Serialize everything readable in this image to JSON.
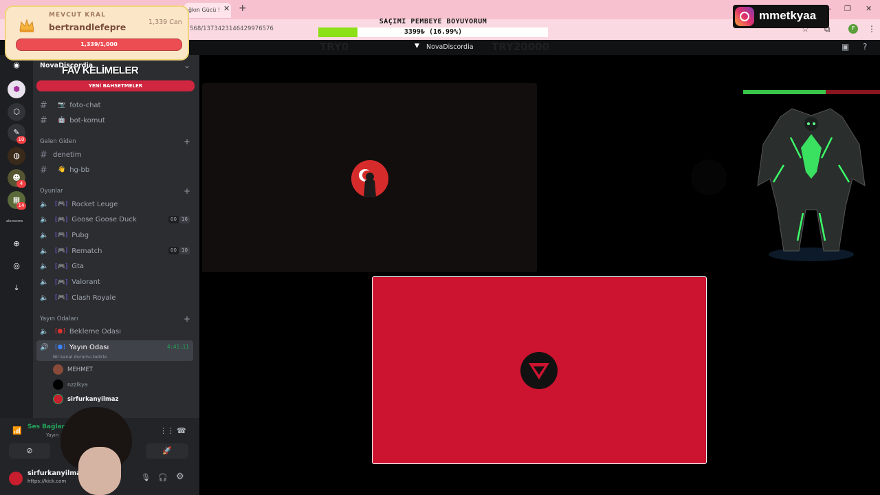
{
  "browser": {
    "tab_title": "ğkın Gücü !",
    "url": "568/1373423146429976576"
  },
  "donation": {
    "title": "SAÇIMI PEMBEYE BOYUYORUM",
    "amount": "3399₺ (16.99%)",
    "progress": 0.1699
  },
  "instagram": {
    "handle": "mmetkyaa"
  },
  "discord": {
    "server_name": "NovaDiscordia",
    "header_ghost_left": "TRY0",
    "header_ghost_right": "TRY20000"
  },
  "king": {
    "label": "MEVCUT KRAL",
    "name": "bertrandlefepre",
    "currency": "1,339 Can",
    "bar_text": "1,339/1,000",
    "progress": 1
  },
  "overlay": {
    "fav_title": "FAV KELİMELER",
    "yeni_label": "YENİ BAHSETMELER"
  },
  "rail": {
    "badges": [
      "10",
      "4",
      "14"
    ],
    "label": "akıcıssms"
  },
  "sidebar": {
    "server_label": "NovaDiscordia",
    "text_channels": [
      {
        "name": "foto-chat",
        "emoji": "📷"
      },
      {
        "name": "bot-komut",
        "emoji": "🤖"
      }
    ],
    "gelen_giden": {
      "title": "Gelen Giden",
      "channels": [
        {
          "name": "denetim",
          "emoji": ""
        },
        {
          "name": "hg-bb",
          "emoji": "👋"
        }
      ]
    },
    "oyunlar": {
      "title": "Oyunlar",
      "channels": [
        {
          "name": "Rocket Leuge",
          "count_a": "",
          "count_b": ""
        },
        {
          "name": "Goose Goose Duck",
          "count_a": "00",
          "count_b": "16"
        },
        {
          "name": "Pubg",
          "count_a": "",
          "count_b": ""
        },
        {
          "name": "Rematch",
          "count_a": "00",
          "count_b": "10"
        },
        {
          "name": "Gta",
          "count_a": "",
          "count_b": ""
        },
        {
          "name": "Valorant",
          "count_a": "",
          "count_b": ""
        },
        {
          "name": "Clash Royale",
          "count_a": "",
          "count_b": ""
        }
      ]
    },
    "yayin": {
      "title": "Yayın Odaları",
      "waiting_room": "Bekleme Odası",
      "stream_room": "Yayın Odası",
      "stream_time": "4:41:11",
      "status_hint": "Bir kanal durumu belirle",
      "users": [
        "MEHMET",
        "nzzlkya",
        "sirfurkanyilmaz"
      ]
    }
  },
  "user_panel": {
    "voice_status": "Ses Bağlan",
    "voice_channel": "Yayın",
    "username": "sirfurkanyilmaz",
    "substatus": "https://kick.com"
  },
  "colors": {
    "discord_bg": "#2b2d31",
    "stream_tile": "#cc1430",
    "donation_fill": "#8ce018",
    "king_bar": "#ec4d52"
  }
}
